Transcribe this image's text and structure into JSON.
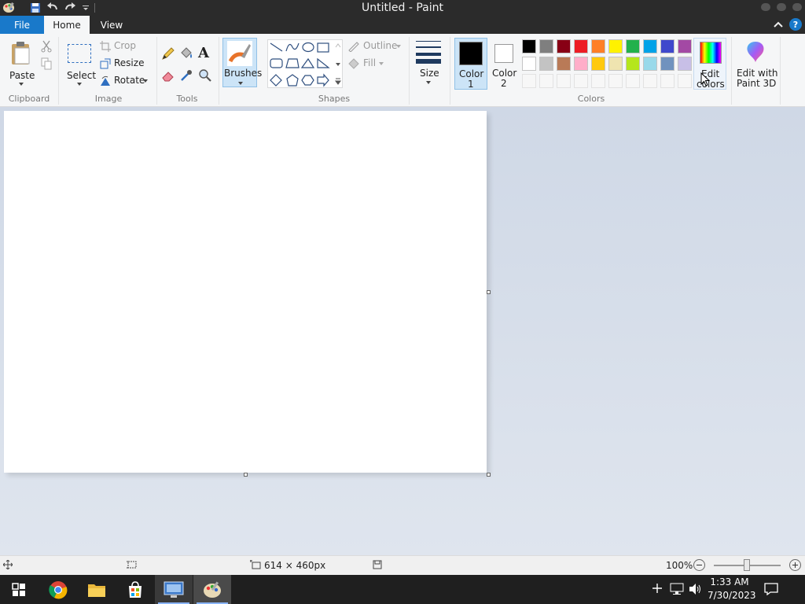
{
  "window": {
    "title": "Untitled - Paint"
  },
  "tabs": {
    "file": "File",
    "home": "Home",
    "view": "View"
  },
  "ribbon": {
    "clipboard": {
      "paste": "Paste",
      "group": "Clipboard"
    },
    "image": {
      "select": "Select",
      "crop": "Crop",
      "resize": "Resize",
      "rotate": "Rotate",
      "group": "Image"
    },
    "tools": {
      "group": "Tools"
    },
    "brushes": {
      "label": "Brushes"
    },
    "shapes": {
      "outline": "Outline",
      "fill": "Fill",
      "group": "Shapes"
    },
    "size": {
      "label": "Size"
    },
    "colors": {
      "color1_line1": "Color",
      "color1_line2": "1",
      "color2_line1": "Color",
      "color2_line2": "2",
      "edit_line1": "Edit",
      "edit_line2": "colors",
      "group": "Colors",
      "color1_value": "#000000",
      "color2_value": "#ffffff",
      "palette_row1": [
        "#000000",
        "#7f7f7f",
        "#880015",
        "#ed1c24",
        "#ff7f27",
        "#fff200",
        "#22b14c",
        "#00a2e8",
        "#3f48cc",
        "#a349a4"
      ],
      "palette_row2": [
        "#ffffff",
        "#c3c3c3",
        "#b97a57",
        "#ffaec9",
        "#ffc90e",
        "#efe4b0",
        "#b5e61d",
        "#99d9ea",
        "#7092be",
        "#c8bfe7"
      ]
    },
    "paint3d": {
      "line1": "Edit with",
      "line2": "Paint 3D"
    }
  },
  "status": {
    "dimensions": "614 × 460px",
    "zoom": "100%"
  },
  "taskbar": {
    "time": "1:33 AM",
    "date": "7/30/2023"
  }
}
